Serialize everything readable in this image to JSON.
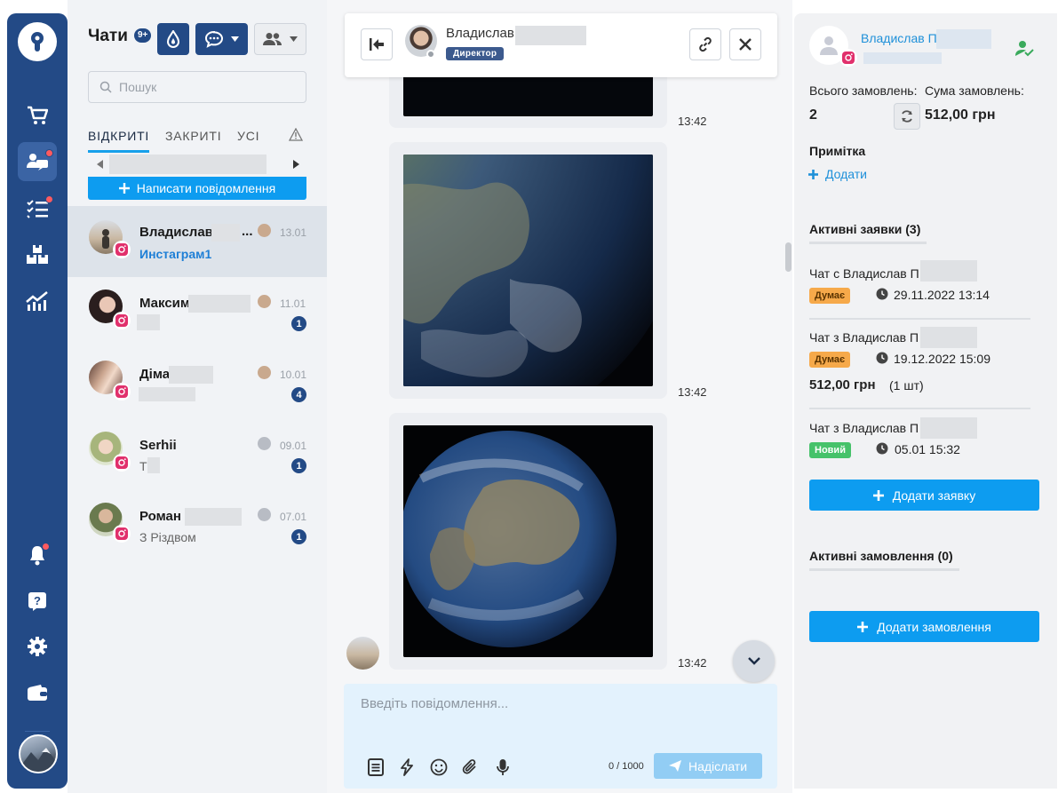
{
  "sidebar": {
    "items": [
      {
        "name": "shop-cart-icon"
      },
      {
        "name": "chats-icon",
        "active": true,
        "dot": true
      },
      {
        "name": "tasks-icon",
        "dot": true
      },
      {
        "name": "warehouse-icon"
      },
      {
        "name": "analytics-icon"
      },
      {
        "name": "bell-icon",
        "dot": true
      },
      {
        "name": "help-icon"
      },
      {
        "name": "settings-icon"
      },
      {
        "name": "wallet-icon"
      }
    ]
  },
  "chat_list": {
    "title": "Чати",
    "badge": "9+",
    "search_placeholder": "Пошук",
    "tabs": [
      "ВІДКРИТІ",
      "ЗАКРИТІ",
      "УСІ"
    ],
    "new_message_label": "Написати повідомлення",
    "chats": [
      {
        "name": "Владислав",
        "name_suffix": "...",
        "date": "13.01",
        "subtitle": "Инстаграм1",
        "unread": "",
        "selected": true
      },
      {
        "name": "Максим",
        "name_suffix": "",
        "date": "11.01",
        "subtitle": "",
        "unread": "1"
      },
      {
        "name": "Діма",
        "name_suffix": "",
        "date": "10.01",
        "subtitle": "",
        "unread": "4"
      },
      {
        "name": "Serhii",
        "name_suffix": "",
        "date": "09.01",
        "subtitle": "Т",
        "unread": "1"
      },
      {
        "name": "Роман",
        "name_suffix": "",
        "date": "07.01",
        "subtitle": "З Різдвом",
        "unread": "1"
      }
    ]
  },
  "conversation": {
    "contact_name": "Владислав",
    "contact_role": "Директор",
    "message_times": [
      "13:42",
      "13:42",
      "13:42"
    ],
    "composer_placeholder": "Введіть повідомлення...",
    "char_counter": "0 / 1000",
    "send_label": "Надіслати"
  },
  "client_panel": {
    "name": "Владислав П",
    "total_orders_label": "Всього замовлень:",
    "total_orders_value": "2",
    "orders_sum_label": "Сума замовлень:",
    "orders_sum_value": "512,00 грн",
    "note_label": "Примітка",
    "add_note_label": "Додати",
    "active_requests_label": "Активні заявки (3)",
    "requests": [
      {
        "title": "Чат с Владислав П",
        "status": "Думає",
        "status_color": "#f6a94a",
        "datetime": "29.11.2022 13:14",
        "amount": "",
        "qty": ""
      },
      {
        "title": "Чат з Владислав П",
        "status": "Думає",
        "status_color": "#f6a94a",
        "datetime": "19.12.2022 15:09",
        "amount": "512,00 грн",
        "qty": "(1 шт)"
      },
      {
        "title": "Чат з Владислав П",
        "status": "Новий",
        "status_color": "#46c26a",
        "datetime": "05.01 15:32",
        "amount": "",
        "qty": ""
      }
    ],
    "add_request_label": "Додати заявку",
    "active_orders_label": "Активні замовлення (0)",
    "add_order_label": "Додати замовлення"
  },
  "colors": {
    "rail": "#234a86",
    "accent": "#0d9cf0",
    "tab_underline": "#17a0ea",
    "badge": "#234a86"
  }
}
